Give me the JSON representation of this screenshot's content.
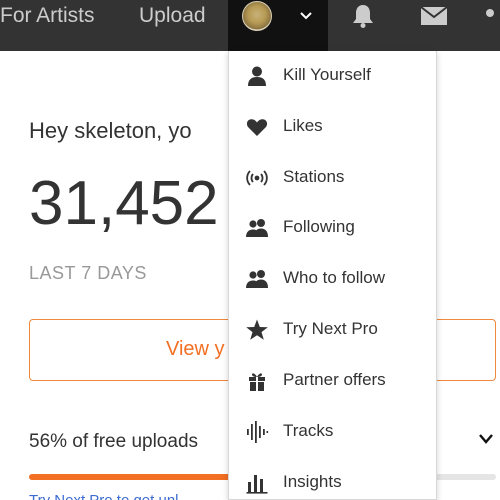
{
  "header": {
    "for_artists": "For Artists",
    "upload": "Upload",
    "avatar_icon": "avatar-icon",
    "profile_menu_icon": "chevron-down-icon",
    "notifications_icon": "bell-icon",
    "messages_icon": "mail-icon",
    "more_icon": "more-icon"
  },
  "main": {
    "greeting": "Hey skeleton, yo",
    "big_number": "31,452",
    "period": "LAST 7 DAYS",
    "view_button": "View y",
    "uploads_text": "56% of free uploads",
    "uploads_progress": 0.56,
    "try_text": "Try Next Pro to get unl"
  },
  "dropdown": {
    "items": [
      {
        "label": "Kill Yourself",
        "icon": "user-icon"
      },
      {
        "label": "Likes",
        "icon": "heart-icon"
      },
      {
        "label": "Stations",
        "icon": "stations-icon"
      },
      {
        "label": "Following",
        "icon": "users-icon"
      },
      {
        "label": "Who to follow",
        "icon": "users-add-icon"
      },
      {
        "label": "Try Next Pro",
        "icon": "star-icon"
      },
      {
        "label": "Partner offers",
        "icon": "gift-icon"
      },
      {
        "label": "Tracks",
        "icon": "waveform-icon"
      },
      {
        "label": "Insights",
        "icon": "bar-chart-icon"
      }
    ]
  },
  "colors": {
    "topbar": "#333333",
    "accent": "#f26f23",
    "link": "#3b6bd1"
  }
}
